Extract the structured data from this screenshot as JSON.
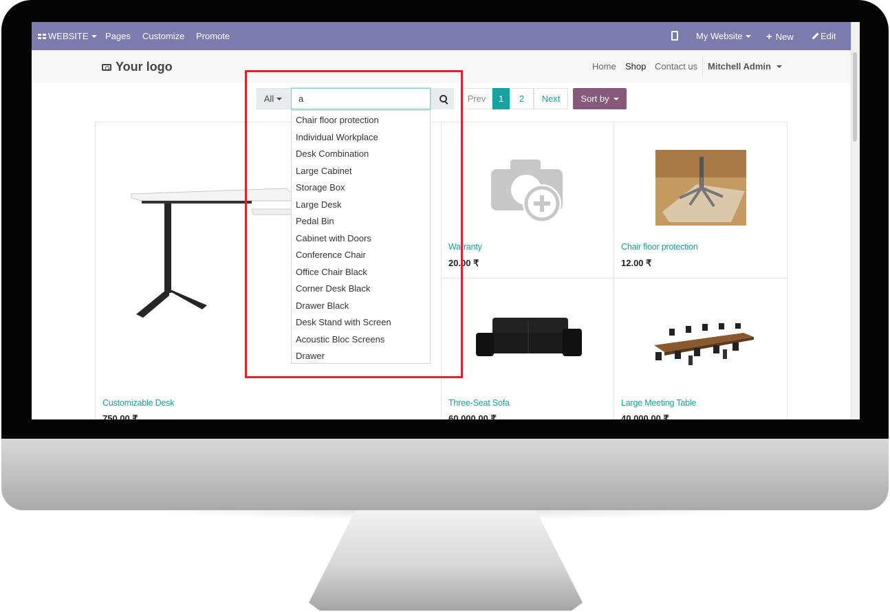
{
  "topbar": {
    "website_label": "WEBSITE",
    "menu": [
      "Pages",
      "Customize",
      "Promote"
    ],
    "my_website_label": "My Website",
    "new_label": "New",
    "edit_label": "Edit"
  },
  "header": {
    "logo_text": "Your logo",
    "nav": [
      "Home",
      "Shop",
      "Contact us"
    ],
    "user_name": "Mitchell Admin"
  },
  "search": {
    "category_label": "All",
    "query": "a"
  },
  "pager": {
    "prev_label": "Prev",
    "pages": [
      "1",
      "2"
    ],
    "current_page": "1",
    "next_label": "Next"
  },
  "sort_label": "Sort by",
  "autocomplete": [
    "Chair floor protection",
    "Individual Workplace",
    "Desk Combination",
    "Large Cabinet",
    "Storage Box",
    "Large Desk",
    "Pedal Bin",
    "Cabinet with Doors",
    "Conference Chair",
    "Office Chair Black",
    "Corner Desk Black",
    "Drawer Black",
    "Desk Stand with Screen",
    "Acoustic Bloc Screens",
    "Drawer"
  ],
  "products": [
    {
      "name": "Customizable Desk",
      "price": "750.00 ₹"
    },
    {
      "name": "Warranty",
      "price": "20.00 ₹"
    },
    {
      "name": "Chair floor protection",
      "price": "12.00 ₹"
    },
    {
      "name": "Three-Seat Sofa",
      "price": "60,000.00 ₹"
    },
    {
      "name": "Large Meeting Table",
      "price": "40,000.00 ₹"
    }
  ],
  "colors": {
    "admin_bar": "#7c7bad",
    "accent_teal": "#17a2a2",
    "sort_button": "#875a7b",
    "highlight": "#e3202c"
  },
  "icons": [
    "website-apps-icon",
    "mobile-icon",
    "plus-icon",
    "pencil-icon",
    "camera-icon",
    "search-icon",
    "image-placeholder-icon"
  ]
}
